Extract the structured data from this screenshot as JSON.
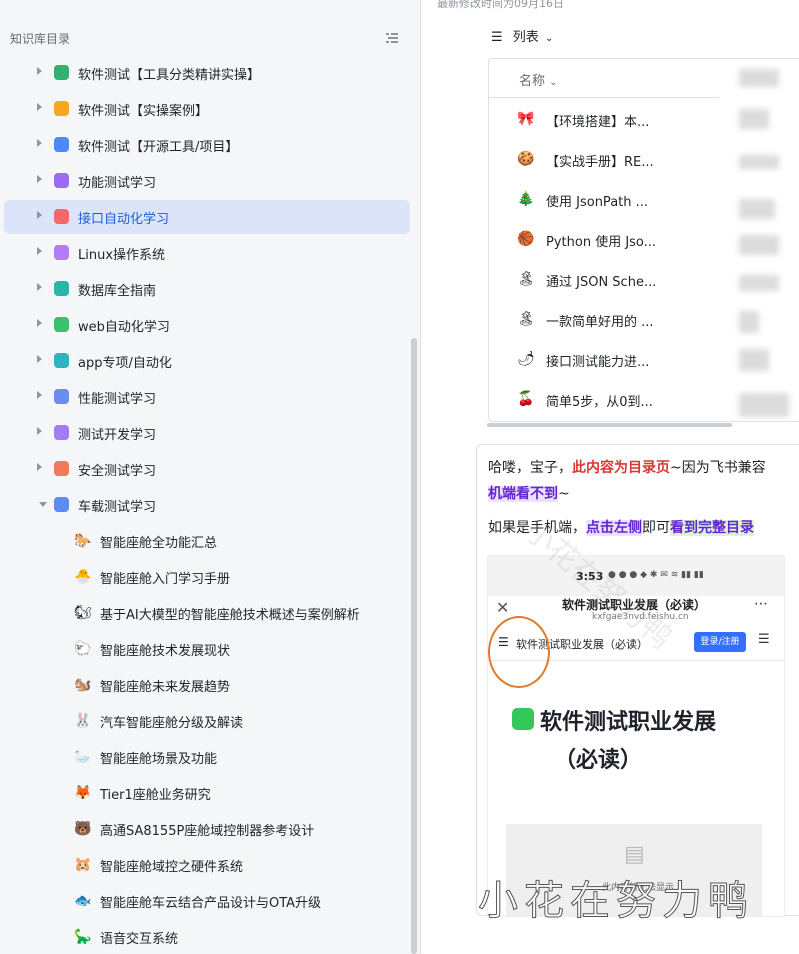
{
  "sidebar": {
    "header": "知识库目录",
    "items": [
      {
        "label": "软件测试【工具分类精讲实操】",
        "color": "#33b06e"
      },
      {
        "label": "软件测试【实操案例】",
        "color": "#f5a623"
      },
      {
        "label": "软件测试【开源工具/项目】",
        "color": "#4c8bf5"
      },
      {
        "label": "功能测试学习",
        "color": "#9b6bf2"
      },
      {
        "label": "接口自动化学习",
        "color": "#f06a6a"
      },
      {
        "label": "Linux操作系统",
        "color": "#b57af5"
      },
      {
        "label": "数据库全指南",
        "color": "#2bb5a8"
      },
      {
        "label": "web自动化学习",
        "color": "#3cc16b"
      },
      {
        "label": "app专项/自动化",
        "color": "#2fb3c0"
      },
      {
        "label": "性能测试学习",
        "color": "#6d8cf0"
      },
      {
        "label": "测试开发学习",
        "color": "#a37bf2"
      },
      {
        "label": "安全测试学习",
        "color": "#f07a5a"
      },
      {
        "label": "车载测试学习",
        "color": "#5b8def"
      }
    ],
    "children": [
      {
        "emoji": "🐎",
        "label": "智能座舱全功能汇总"
      },
      {
        "emoji": "🐣",
        "label": "智能座舱入门学习手册"
      },
      {
        "emoji": "🐿",
        "label": "基于AI大模型的智能座舱技术概述与案例解析"
      },
      {
        "emoji": "🐑",
        "label": "智能座舱技术发展现状"
      },
      {
        "emoji": "🐿️",
        "label": "智能座舱未来发展趋势"
      },
      {
        "emoji": "🐰",
        "label": "汽车智能座舱分级及解读"
      },
      {
        "emoji": "🦢",
        "label": "智能座舱场景及功能"
      },
      {
        "emoji": "🦊",
        "label": "Tier1座舱业务研究"
      },
      {
        "emoji": "🐻",
        "label": "高通SA8155P座舱域控制器参考设计"
      },
      {
        "emoji": "🐹",
        "label": "智能座舱域控之硬件系统"
      },
      {
        "emoji": "🐟",
        "label": "智能座舱车云结合产品设计与OTA升级"
      },
      {
        "emoji": "🦕",
        "label": "语音交互系统"
      }
    ]
  },
  "main": {
    "modified": "最新修改时间为09月16日",
    "view_toggle": "列表",
    "column_header": "名称",
    "rows": [
      {
        "emoji": "🎀",
        "name": "【环境搭建】本..."
      },
      {
        "emoji": "🍪",
        "name": "【实战手册】RE..."
      },
      {
        "emoji": "🎄",
        "name": "使用 JsonPath ..."
      },
      {
        "emoji": "🏀",
        "name": "Python 使用 Jso..."
      },
      {
        "emoji": "🏝",
        "name": "通过 JSON Sche..."
      },
      {
        "emoji": "🏝",
        "name": "一款简单好用的 ..."
      },
      {
        "emoji": "🌶",
        "name": "接口测试能力进..."
      },
      {
        "emoji": "🍒",
        "name": "简单5步，从0到..."
      }
    ]
  },
  "callout": {
    "l1_a": "哈喽，宝子，",
    "l1_b": "此内容为目录页",
    "l1_c": "~因为飞书兼容",
    "l2_a": "机端看不到",
    "l2_b": "~",
    "l3_a": "如果是手机端，",
    "l3_b": "点击左侧",
    "l3_c": "即可",
    "l3_d": "看到完整目录"
  },
  "phone": {
    "time": "3:53",
    "title": "软件测试职业发展（必读）",
    "url": "kxfgae3nvd.feishu.cn",
    "doc_title": "软件测试职业发展（必读）",
    "login": "登录/注册",
    "big_title": "软件测试职业发展",
    "big_sub": "（必读）",
    "box_text": "此内容暂无法显示"
  },
  "watermark": "小花在努力鸭",
  "watermark_faint": "小花在努力鸭"
}
